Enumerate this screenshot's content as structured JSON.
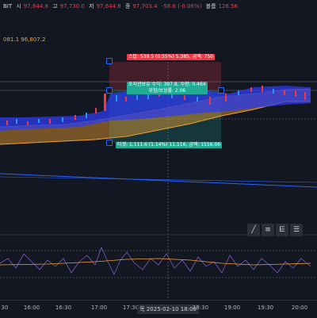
{
  "header": {
    "symbol_suffix": "BIT",
    "open_label": "시",
    "open_value": "97,644.8",
    "high_label": "고",
    "high_value": "97,730.0",
    "low_label": "저",
    "low_value": "97,644.8",
    "close_label": "종",
    "close_value": "97,703.4",
    "change": "-58.6 (-0.06%)",
    "volume_label": "볼륨",
    "volume_value": "126.56",
    "indicator_values": "081.1  96,807.2"
  },
  "position": {
    "stop_text": "스탑: 538.5 (0.55%) 5,385, 금액: 750",
    "entry_line1": "포지션보유 수익: 397.8, 수량: 0.464",
    "entry_line2": "위험/보상률: 2.06",
    "target_text": "타겟: 1,111.6 (1.14%) 11,116, 금액: 1516.06"
  },
  "x_axis": {
    "ticks": [
      "30",
      "16:00",
      "16:30",
      "17:00",
      "17:30",
      "목 2025-02-10  18:00",
      "18:30",
      "19:00",
      "19:30",
      "20:00"
    ],
    "highlight_index": 5
  },
  "tools": [
    "draw-line-icon",
    "fib-icon",
    "gann-icon",
    "pitchfork-icon"
  ],
  "colors": {
    "background": "#131722",
    "up": "#2196f3",
    "down": "#f23645",
    "profit_zone": "#22ab94",
    "loss_zone": "#f23645",
    "band_fill": "#f0a030",
    "rsi": "#7e57c2"
  }
}
